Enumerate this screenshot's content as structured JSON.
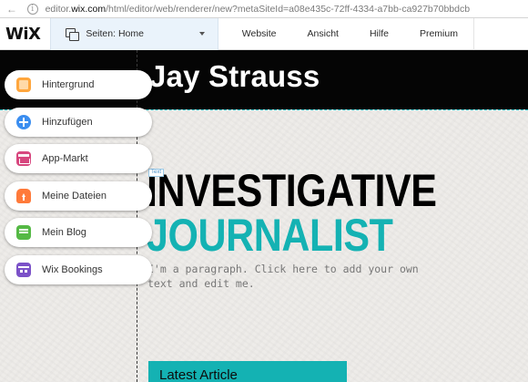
{
  "browser": {
    "url_prefix": "editor.",
    "url_domain": "wix.com",
    "url_rest": "/html/editor/web/renderer/new?metaSiteId=a08e435c-72ff-4334-a7bb-ca927b70bbdcb"
  },
  "topbar": {
    "logo": "WiX",
    "pages_label": "Seiten: Home",
    "menu": [
      "Website",
      "Ansicht",
      "Hilfe",
      "Premium"
    ]
  },
  "left_panel": {
    "items": [
      {
        "label": "Hintergrund",
        "icon": "background-icon",
        "color": "#ffa63d"
      },
      {
        "label": "Hinzufügen",
        "icon": "add-icon",
        "color": "#3b8ef0"
      },
      {
        "label": "App-Markt",
        "icon": "app-market-icon",
        "color": "#d7467e"
      },
      {
        "label": "Meine Dateien",
        "icon": "upload-icon",
        "color": "#ff7a3a"
      },
      {
        "label": "Mein Blog",
        "icon": "blog-icon",
        "color": "#55b945"
      },
      {
        "label": "Wix Bookings",
        "icon": "bookings-icon",
        "color": "#7b51c8"
      }
    ]
  },
  "site": {
    "name": "Jay Strauss",
    "text_tag": "Text",
    "headline_line1": "INVESTIGATIVE",
    "headline_line2": "JOURNALIST",
    "paragraph": "I'm a paragraph. Click here to add your own text and edit me.",
    "article_title": "Latest Article"
  },
  "colors": {
    "accent": "#14b2b3",
    "header_bg": "#050505"
  }
}
